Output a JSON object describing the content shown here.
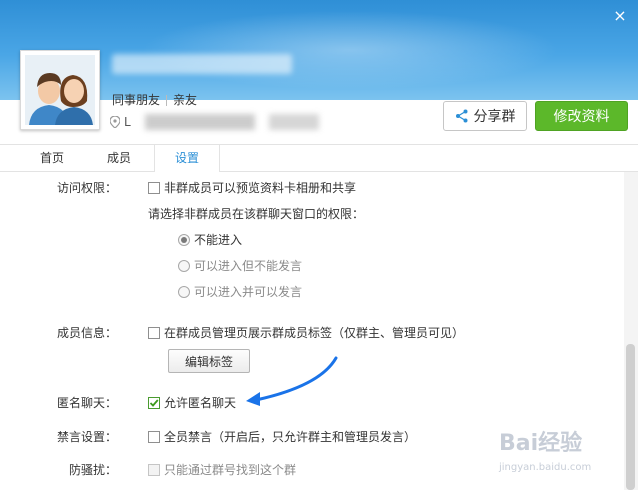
{
  "window": {
    "close_icon": "close-icon"
  },
  "profile": {
    "tags": [
      "同事朋友",
      "亲友"
    ],
    "location_prefix": "L"
  },
  "actions": {
    "share_label": "分享群",
    "edit_label": "修改资料"
  },
  "tabs": [
    {
      "label": "首页",
      "active": false
    },
    {
      "label": "成员",
      "active": false
    },
    {
      "label": "设置",
      "active": true
    }
  ],
  "settings": {
    "access": {
      "label": "访问权限：",
      "preview_option": "非群成员可以预览资料卡相册和共享",
      "choose_text": "请选择非群成员在该群聊天窗口的权限：",
      "radios": [
        "不能进入",
        "可以进入但不能发言",
        "可以进入并可以发言"
      ]
    },
    "member_info": {
      "label": "成员信息：",
      "option": "在群成员管理页展示群成员标签（仅群主、管理员可见）",
      "edit_tags_button": "编辑标签"
    },
    "anonymous": {
      "label": "匿名聊天：",
      "option": "允许匿名聊天"
    },
    "mute": {
      "label": "禁言设置：",
      "option": "全员禁言（开启后，只允许群主和管理员发言）"
    },
    "anti_spam": {
      "label": "防骚扰：",
      "option": "只能通过群号找到这个群"
    }
  },
  "watermark": {
    "brand": "Bai经验",
    "url": "jingyan.baidu.com"
  },
  "colors": {
    "header": "#3a9be0",
    "primary_green": "#5cb82a",
    "tab_active": "#2b8fd6",
    "arrow": "#1a73e8"
  }
}
